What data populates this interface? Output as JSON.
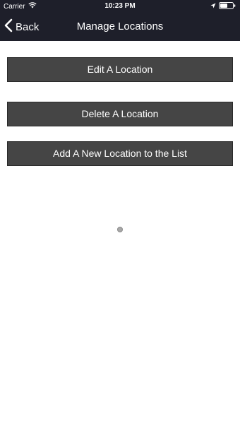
{
  "status_bar": {
    "carrier": "Carrier",
    "time": "10:23 PM",
    "wifi_icon": "wifi-icon",
    "location_icon": "location-arrow-icon",
    "battery_icon": "battery-icon"
  },
  "nav": {
    "back_label": "Back",
    "title": "Manage Locations",
    "back_icon": "chevron-left-icon"
  },
  "actions": {
    "edit_label": "Edit A Location",
    "delete_label": "Delete A Location",
    "add_label": "Add A New Location to the List"
  },
  "colors": {
    "nav_background": "#1e1f2a",
    "button_background": "#454545",
    "button_text": "#ffffff"
  }
}
